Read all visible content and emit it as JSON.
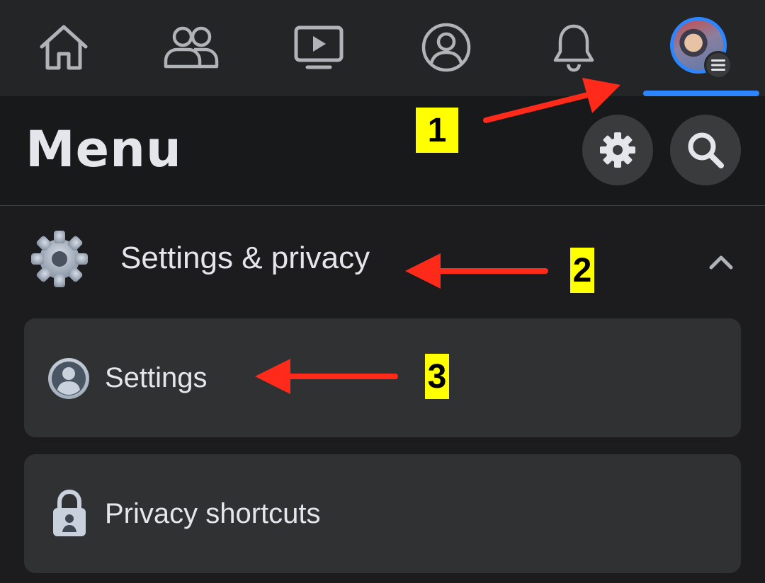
{
  "nav": {
    "items": [
      {
        "name": "home",
        "icon": "home-icon"
      },
      {
        "name": "friends",
        "icon": "friends-icon"
      },
      {
        "name": "watch",
        "icon": "video-icon"
      },
      {
        "name": "profile",
        "icon": "profile-icon"
      },
      {
        "name": "notifications",
        "icon": "bell-icon"
      },
      {
        "name": "menu",
        "icon": "avatar-menu-icon",
        "active": true
      }
    ],
    "active_color": "#2d86ff"
  },
  "header": {
    "title": "Menu",
    "buttons": [
      {
        "name": "settings",
        "icon": "gear-icon"
      },
      {
        "name": "search",
        "icon": "search-icon"
      }
    ]
  },
  "section": {
    "label": "Settings & privacy",
    "icon": "gear-icon",
    "expanded": true
  },
  "items": [
    {
      "label": "Settings",
      "icon": "user-circle-icon"
    },
    {
      "label": "Privacy shortcuts",
      "icon": "lock-icon"
    }
  ],
  "annotations": [
    {
      "number": "1",
      "color": "#ffff00"
    },
    {
      "number": "2",
      "color": "#ffff00"
    },
    {
      "number": "3",
      "color": "#ffff00"
    }
  ],
  "colors": {
    "background": "#1c1c1e",
    "topbar": "#242526",
    "card": "#303133",
    "text": "#e4e6eb",
    "arrow": "#ff2a1a"
  }
}
